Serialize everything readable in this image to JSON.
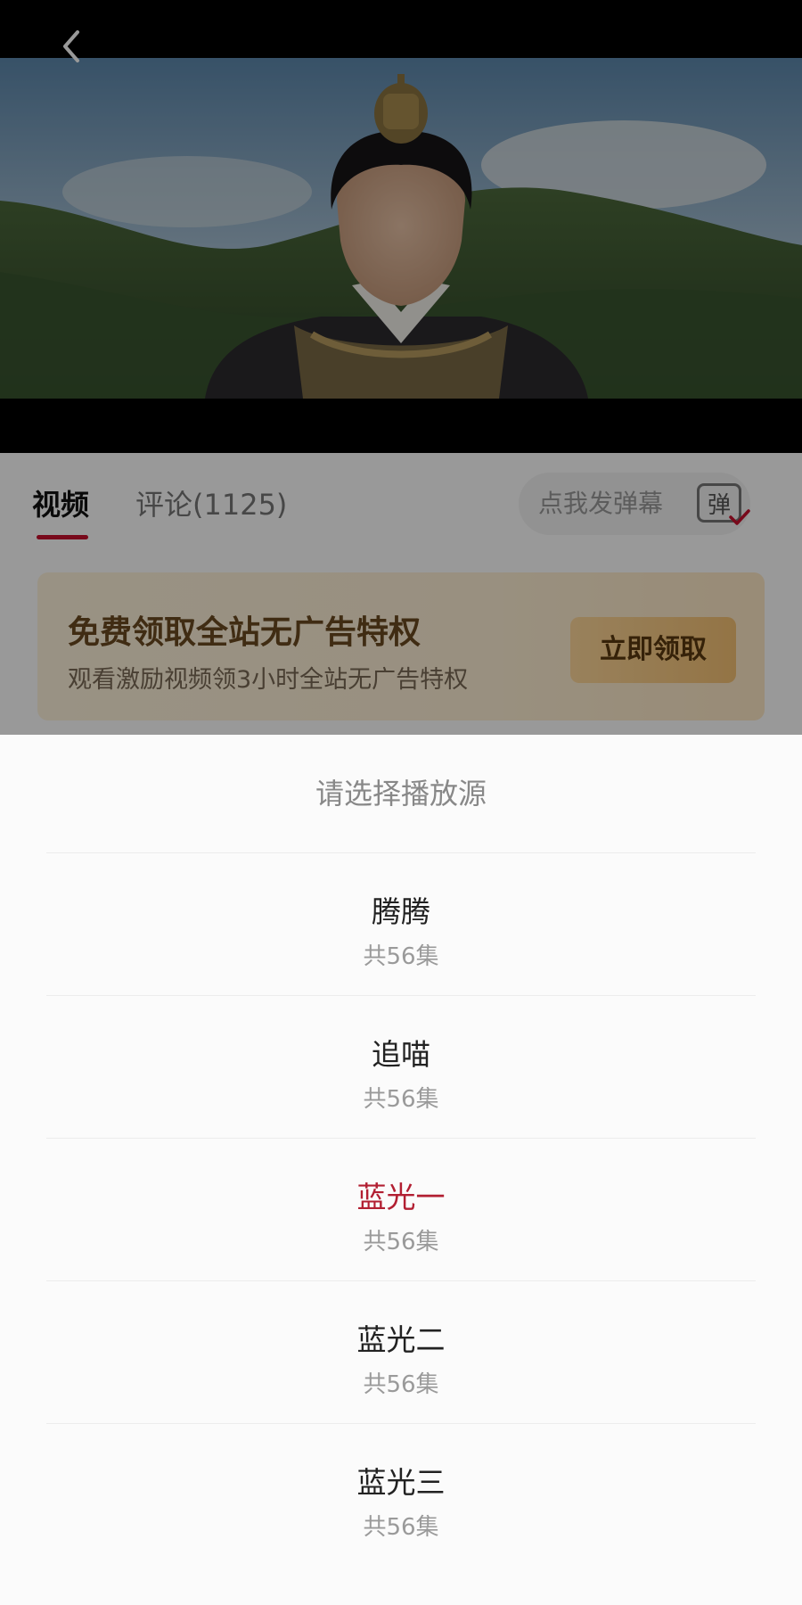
{
  "colors": {
    "accent": "#c8102e",
    "active_source": "#b21f32",
    "promo_text": "#6b4a20",
    "sheet_background": "#fbfbfb"
  },
  "player": {
    "back_icon": "chevron-left-icon"
  },
  "tabs": {
    "video_label": "视频",
    "comments_label": "评论(1125)",
    "active": "视频"
  },
  "danmaku": {
    "placeholder": "点我发弹幕",
    "toggle_label": "弹",
    "toggle_icon": "check-icon"
  },
  "promo": {
    "title": "免费领取全站无广告特权",
    "subtitle": "观看激励视频领3小时全站无广告特权",
    "button_label": "立即领取"
  },
  "source_sheet": {
    "title": "请选择播放源",
    "sources": [
      {
        "name": "腾腾",
        "count": "共56集",
        "active": false
      },
      {
        "name": "追喵",
        "count": "共56集",
        "active": false
      },
      {
        "name": "蓝光一",
        "count": "共56集",
        "active": true
      },
      {
        "name": "蓝光二",
        "count": "共56集",
        "active": false
      },
      {
        "name": "蓝光三",
        "count": "共56集",
        "active": false
      }
    ]
  }
}
